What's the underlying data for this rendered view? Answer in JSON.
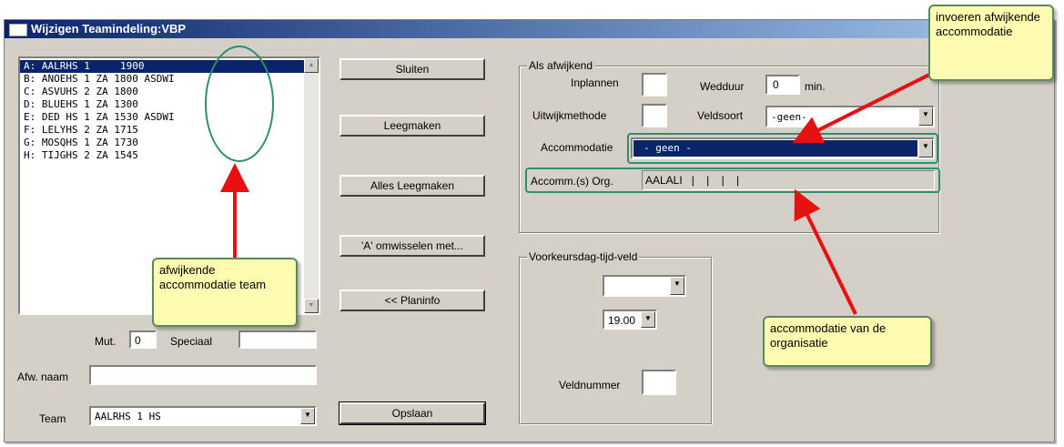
{
  "window": {
    "title": "Wijzigen Teamindeling:VBP"
  },
  "team_list": {
    "rows": [
      "A: AALRHS 1     1900",
      "B: ANOEHS 1 ZA 1800 ASDWI",
      "C: ASVUHS 2 ZA 1800",
      "D: BLUEHS 1 ZA 1300",
      "E: DED HS 1 ZA 1530 ASDWI",
      "F: LELYHS 2 ZA 1715",
      "G: MOSQHS 1 ZA 1730",
      "H: TIJGHS 2 ZA 1545"
    ],
    "selected_index": 0
  },
  "fields": {
    "mut_label": "Mut.",
    "mut_value": "0",
    "speciaal_label": "Speciaal",
    "speciaal_value": "",
    "afw_naam_label": "Afw. naam",
    "afw_naam_value": "",
    "team_label": "Team",
    "team_value": "AALRHS 1 HS"
  },
  "buttons": {
    "sluiten": "Sluiten",
    "leegmaken": "Leegmaken",
    "alles_leegmaken": "Alles Leegmaken",
    "omwisselen": "'A' omwisselen met...",
    "planinfo": "<< Planinfo",
    "opslaan": "Opslaan"
  },
  "afwijkend": {
    "group_title": "Als afwijkend",
    "inplannen_label": "Inplannen",
    "inplannen_value": "",
    "wedduur_label": "Wedduur",
    "wedduur_value": "0",
    "wedduur_unit": "min.",
    "uitwijk_label": "Uitwijkmethode",
    "uitwijk_value": "",
    "veldsoort_label": "Veldsoort",
    "veldsoort_value": "-geen-",
    "accommodatie_label": "Accommodatie",
    "accommodatie_value": "- geen -",
    "accomm_org_label": "Accomm.(s) Org.",
    "accomm_org_value": "AALALI   |    |    |    |"
  },
  "voorkeur": {
    "group_title": "Voorkeursdag-tijd-veld",
    "dag_value": "",
    "tijd_value": "19.00",
    "veldnummer_label": "Veldnummer",
    "veldnummer_value": ""
  },
  "callouts": {
    "invoeren": "invoeren afwijkende accommodatie",
    "afwijkende_team": "afwijkende accommodatie team",
    "organisatie": "accommodatie van de organisatie"
  },
  "colors": {
    "title_bar": "#0a246a",
    "selection": "#0a246a",
    "callout_fill": "#fffbb0",
    "ring": "#2f8f6a",
    "arrow": "#e81010"
  }
}
